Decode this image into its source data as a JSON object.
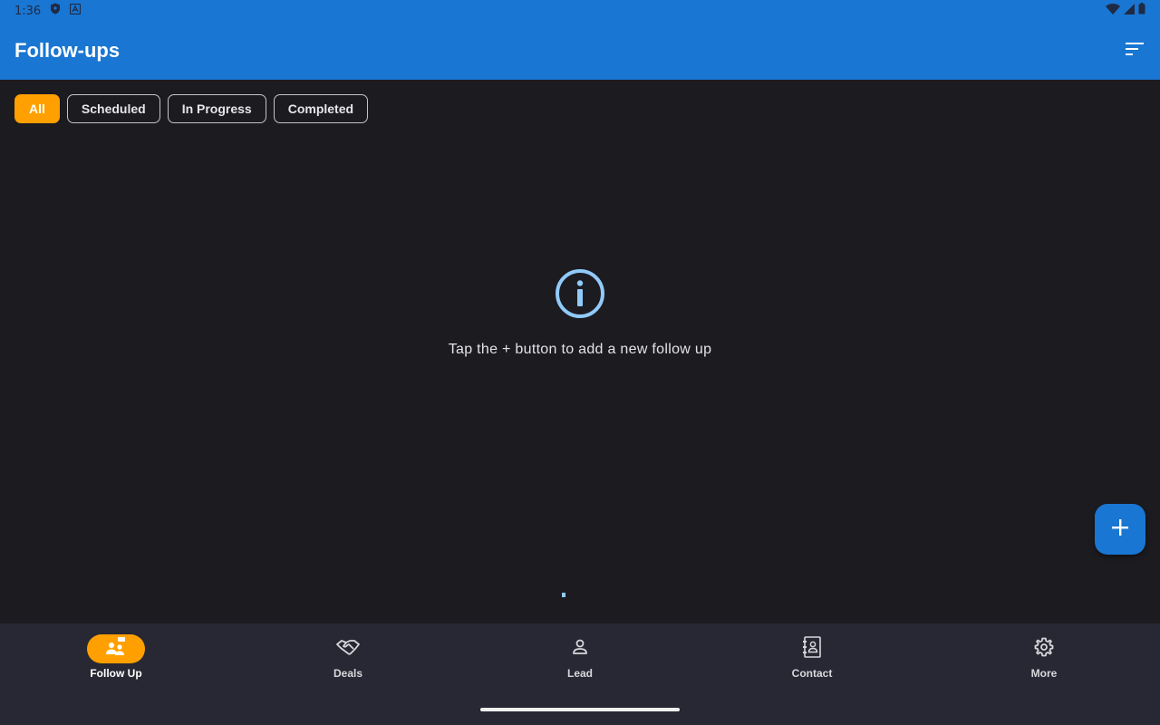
{
  "status_bar": {
    "time": "1:36"
  },
  "app_bar": {
    "title": "Follow-ups",
    "filter_icon": "sort-filter-icon"
  },
  "filters": {
    "chips": [
      {
        "label": "All",
        "selected": true
      },
      {
        "label": "Scheduled",
        "selected": false
      },
      {
        "label": "In Progress",
        "selected": false
      },
      {
        "label": "Completed",
        "selected": false
      }
    ]
  },
  "empty_state": {
    "icon": "info-icon",
    "message": "Tap the + button to add a new follow up"
  },
  "fab": {
    "icon": "plus-icon"
  },
  "bottom_nav": {
    "items": [
      {
        "label": "Follow Up",
        "icon": "follow-up-icon",
        "active": true
      },
      {
        "label": "Deals",
        "icon": "handshake-icon",
        "active": false
      },
      {
        "label": "Lead",
        "icon": "person-icon",
        "active": false
      },
      {
        "label": "Contact",
        "icon": "contact-book-icon",
        "active": false
      },
      {
        "label": "More",
        "icon": "gear-icon",
        "active": false
      }
    ]
  },
  "colors": {
    "primary": "#1976d2",
    "accent": "#ffa000",
    "background": "#1c1b20",
    "nav_background": "#272833",
    "info_icon": "#90caf9"
  }
}
